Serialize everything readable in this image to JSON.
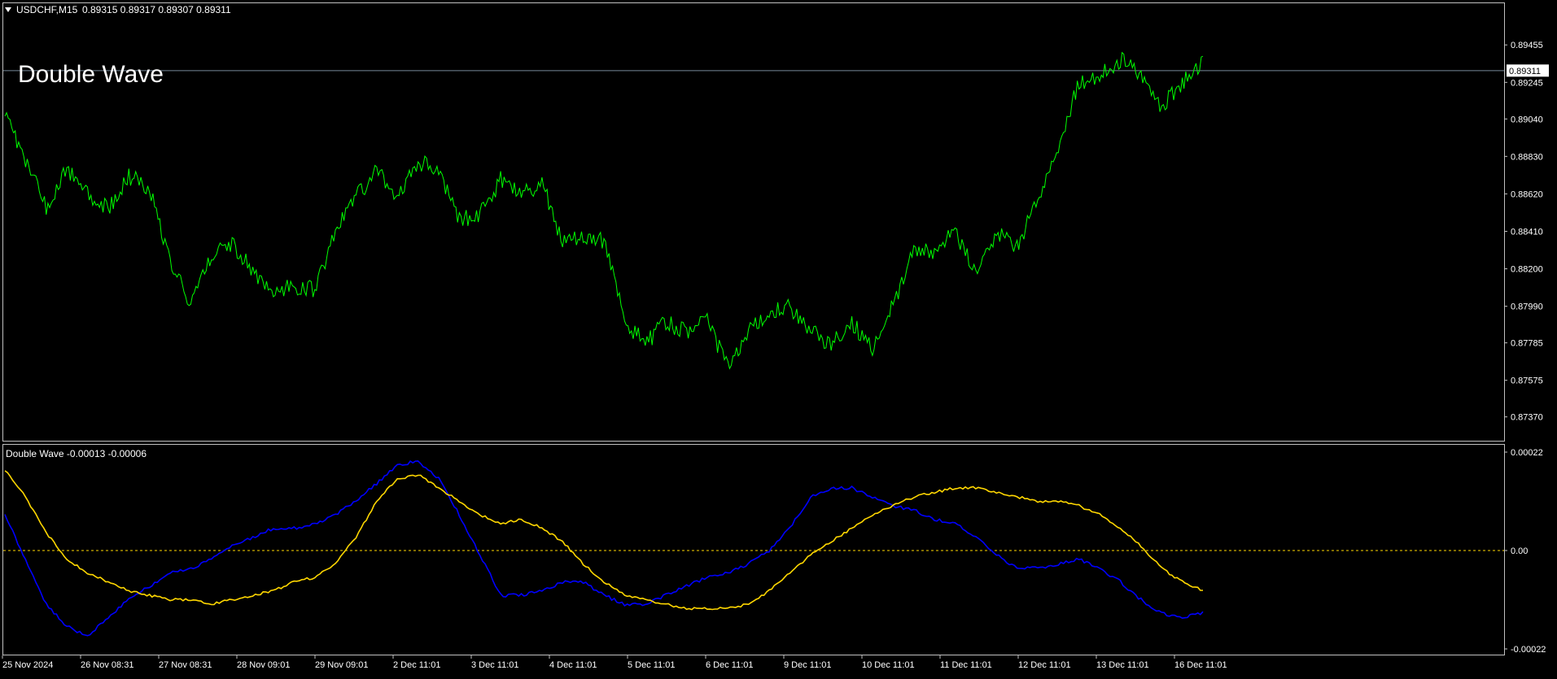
{
  "window": {
    "symbol_header": "USDCHF,M15",
    "ohlc": "0.89315 0.89317 0.89307 0.89311",
    "overlay_title": "Double Wave"
  },
  "indicator": {
    "header": "Double Wave -0.00013 -0.00006"
  },
  "colors": {
    "background": "#000000",
    "frame": "#c0c0c0",
    "text": "#ffffff",
    "price_line": "#00ff00",
    "blue_line": "#0000ff",
    "yellow_line": "#ffd700",
    "bid_line": "#778899",
    "zero_line": "#ffd700"
  },
  "chart_data": [
    {
      "type": "line",
      "title": "USDCHF,M15",
      "x": [
        "25 Nov 2024",
        "26 Nov 08:31",
        "27 Nov 08:31",
        "28 Nov 09:01",
        "29 Nov 09:01",
        "2 Dec 11:01",
        "3 Dec 11:01",
        "4 Dec 11:01",
        "5 Dec 11:01",
        "6 Dec 11:01",
        "9 Dec 11:01",
        "10 Dec 11:01",
        "11 Dec 11:01",
        "12 Dec 11:01",
        "13 Dec 11:01",
        "16 Dec 11:01"
      ],
      "ylim": [
        0.873,
        0.8957
      ],
      "y_ticks": [
        "0.89455",
        "0.89245",
        "0.89040",
        "0.88830",
        "0.88620",
        "0.88410",
        "0.88200",
        "0.87990",
        "0.87785",
        "0.87575",
        "0.87370"
      ],
      "last_price": "0.89311",
      "series": [
        {
          "values": [
            0.891,
            0.888,
            0.8855,
            0.8876,
            0.8862,
            0.8853,
            0.8872,
            0.8866,
            0.8825,
            0.88,
            0.8828,
            0.8835,
            0.8818,
            0.8808,
            0.881,
            0.8808,
            0.8842,
            0.886,
            0.8875,
            0.8858,
            0.888,
            0.8875,
            0.8848,
            0.885,
            0.887,
            0.8862,
            0.8868,
            0.8835,
            0.8838,
            0.8836,
            0.879,
            0.8778,
            0.879,
            0.8785,
            0.879,
            0.8765,
            0.8785,
            0.8795,
            0.8798,
            0.8785,
            0.8778,
            0.879,
            0.8775,
            0.88,
            0.883,
            0.883,
            0.884,
            0.882,
            0.884,
            0.8832,
            0.886,
            0.889,
            0.8925,
            0.8928,
            0.8937,
            0.893,
            0.891,
            0.8925,
            0.8935
          ]
        }
      ]
    },
    {
      "type": "line",
      "title": "Double Wave",
      "x": [
        "25 Nov 2024",
        "26 Nov 08:31",
        "27 Nov 08:31",
        "28 Nov 09:01",
        "29 Nov 09:01",
        "2 Dec 11:01",
        "3 Dec 11:01",
        "4 Dec 11:01",
        "5 Dec 11:01",
        "6 Dec 11:01",
        "9 Dec 11:01",
        "10 Dec 11:01",
        "11 Dec 11:01",
        "12 Dec 11:01",
        "13 Dec 11:01",
        "16 Dec 11:01"
      ],
      "ylim": [
        -0.00022,
        0.00022
      ],
      "y_ticks": [
        "0.00022",
        "0.00",
        "-0.00022"
      ],
      "zero_line": 0,
      "series": [
        {
          "color": "blue",
          "values": [
            8e-05,
            -2e-05,
            -0.00012,
            -0.00017,
            -0.00019,
            -0.00015,
            -0.00011,
            -8e-05,
            -5e-05,
            -4e-05,
            -2e-05,
            1e-05,
            3e-05,
            5e-05,
            5e-05,
            6e-05,
            8e-05,
            0.00011,
            0.00015,
            0.00019,
            0.0002,
            0.00016,
            8e-05,
            -1e-05,
            -0.0001,
            -0.0001,
            -9e-05,
            -7e-05,
            -7e-05,
            -0.0001,
            -0.00012,
            -0.00012,
            -0.0001,
            -8e-05,
            -6e-05,
            -5e-05,
            -3e-05,
            0.0,
            5e-05,
            0.00012,
            0.00014,
            0.00014,
            0.00012,
            0.0001,
            9e-05,
            7e-05,
            6e-05,
            3e-05,
            -1e-05,
            -4e-05,
            -4e-05,
            -3e-05,
            -2e-05,
            -4e-05,
            -7e-05,
            -0.00011,
            -0.00014,
            -0.00015,
            -0.00014
          ]
        },
        {
          "color": "yellow",
          "values": [
            0.00018,
            0.00012,
            4e-05,
            -2e-05,
            -5e-05,
            -7e-05,
            -9e-05,
            -0.0001,
            -0.00011,
            -0.00011,
            -0.00012,
            -0.00011,
            -0.0001,
            -9e-05,
            -7e-05,
            -6e-05,
            -3e-05,
            3e-05,
            0.00011,
            0.00016,
            0.00017,
            0.00014,
            0.00011,
            8e-05,
            6e-05,
            7e-05,
            5e-05,
            2e-05,
            -3e-05,
            -7e-05,
            -0.0001,
            -0.00011,
            -0.00012,
            -0.00013,
            -0.00013,
            -0.00013,
            -0.00012,
            -9e-05,
            -5e-05,
            -1e-05,
            2e-05,
            5e-05,
            8e-05,
            0.0001,
            0.00012,
            0.00013,
            0.00014,
            0.00014,
            0.00013,
            0.00012,
            0.00011,
            0.00011,
            0.0001,
            8e-05,
            5e-05,
            1e-05,
            -4e-05,
            -7e-05,
            -9e-05
          ]
        }
      ]
    }
  ]
}
